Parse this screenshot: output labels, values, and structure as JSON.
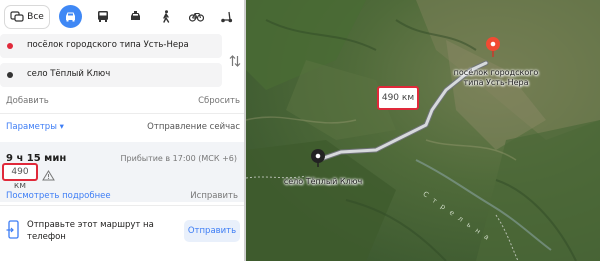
{
  "transport_modes": {
    "all_label": "Все",
    "active": "car",
    "items": [
      "car",
      "bus",
      "taxi",
      "pedestrian",
      "bicycle",
      "scooter",
      "truck"
    ]
  },
  "route_points": {
    "from": "посёлок городского типа Усть-Нера",
    "to": "село Тёплый Ключ",
    "from_color": "#e0293a",
    "to_color": "#333333"
  },
  "actions": {
    "add": "Добавить",
    "reset": "Сбросить"
  },
  "options": {
    "params": "Параметры ▾",
    "departure": "Отправление сейчас"
  },
  "route": {
    "duration": "9 ч 15 мин",
    "arrival": "Прибытие в 17:00 (МСК +6)",
    "distance": "490 км",
    "details": "Посмотреть подробнее",
    "fix": "Исправить"
  },
  "send": {
    "text": "Отправьте этот маршрут на телефон",
    "button": "Отправить"
  },
  "map": {
    "label_destination": "посёлок городского типа Усть-Нера",
    "label_start": "село Тёплый Ключ",
    "distance_badge": "490 км",
    "river_label": "С т р е л ь н а"
  },
  "colors": {
    "accent": "#3d7df5",
    "highlight_red": "#e0293a",
    "route_line": "#c8ccd2"
  }
}
